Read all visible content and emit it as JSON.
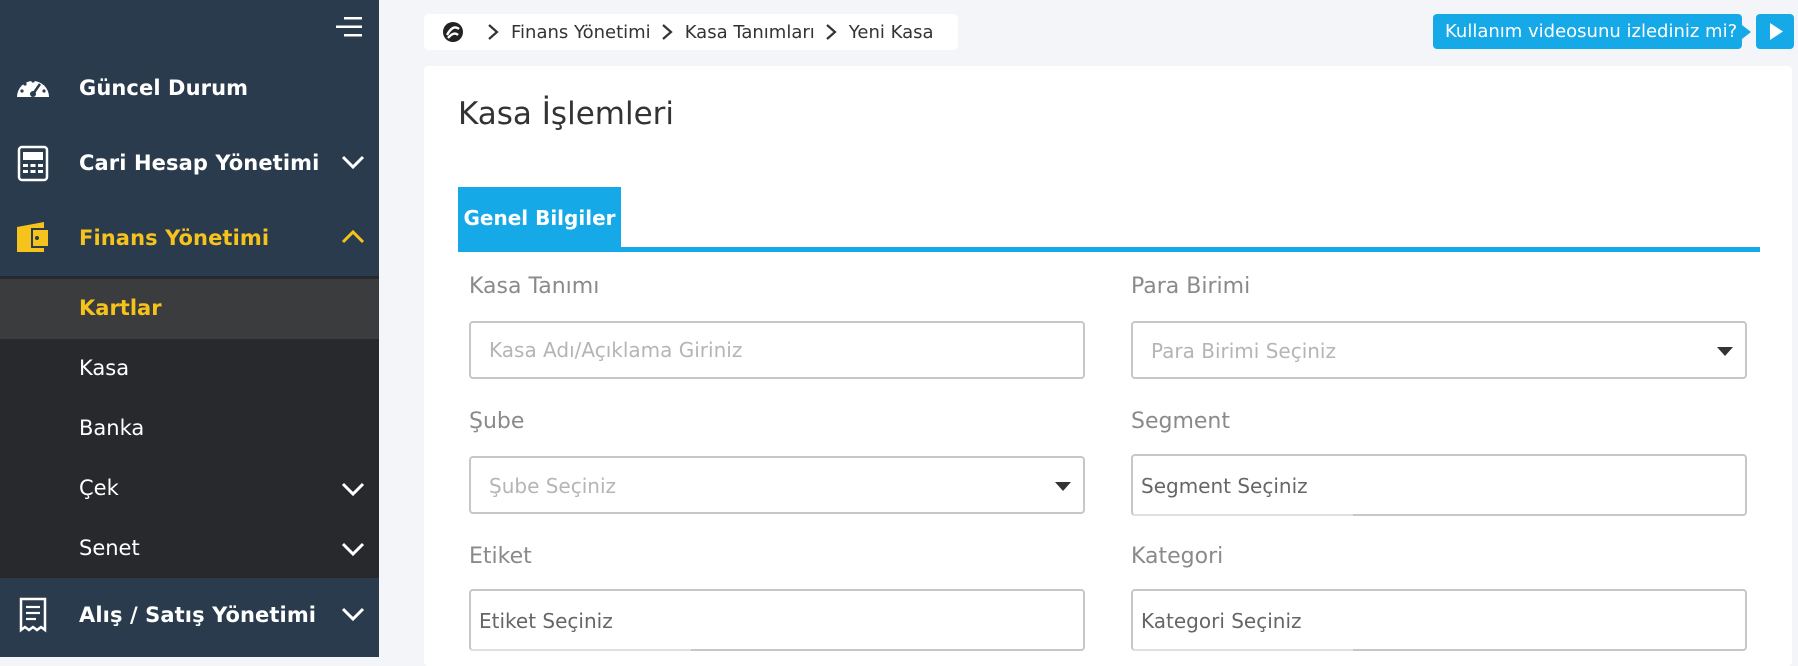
{
  "sidebar": {
    "menu": [
      {
        "label": "Güncel Durum",
        "icon": "dashboard-icon"
      },
      {
        "label": "Cari Hesap Yönetimi",
        "icon": "calculator-icon"
      },
      {
        "label": "Finans Yönetimi",
        "icon": "wallet-icon"
      },
      {
        "label": "Alış / Satış Yönetimi",
        "icon": "receipt-icon"
      }
    ],
    "submenu": [
      {
        "label": "Kartlar"
      },
      {
        "label": "Kasa"
      },
      {
        "label": "Banka"
      },
      {
        "label": "Çek"
      },
      {
        "label": "Senet"
      }
    ],
    "colors": {
      "bg": "#2a3b4e",
      "active": "#f6c31c",
      "submenu_bg": "#27292c"
    }
  },
  "breadcrumb": {
    "items": [
      "Finans Yönetimi",
      "Kasa Tanımları",
      "Yeni Kasa"
    ]
  },
  "video_prompt": {
    "label": "Kullanım videosunu izlediniz mi?"
  },
  "card": {
    "title": "Kasa İşlemleri",
    "tab": "Genel Bilgiler"
  },
  "form": {
    "kasa_tanimi": {
      "label": "Kasa Tanımı",
      "placeholder": "Kasa Adı/Açıklama Giriniz"
    },
    "para_birimi": {
      "label": "Para Birimi",
      "placeholder": "Para Birimi Seçiniz"
    },
    "sube": {
      "label": "Şube",
      "placeholder": "Şube Seçiniz"
    },
    "segment": {
      "label": "Segment",
      "placeholder": "Segment Seçiniz"
    },
    "etiket": {
      "label": "Etiket",
      "placeholder": "Etiket Seçiniz"
    },
    "kategori": {
      "label": "Kategori",
      "placeholder": "Kategori Seçiniz"
    }
  },
  "accent_color": "#16a9e8"
}
